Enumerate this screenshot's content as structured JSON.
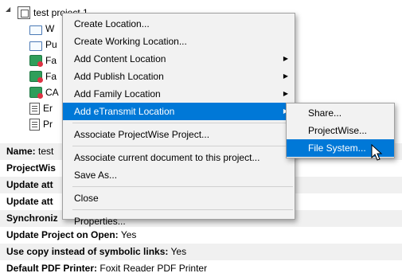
{
  "tree": {
    "root": {
      "label": "test project 1",
      "icon": "project-icon"
    },
    "children": [
      {
        "label": "W",
        "icon": "folder-icon"
      },
      {
        "label": "Pu",
        "icon": "publish-icon"
      },
      {
        "label": "Fa",
        "icon": "family-icon"
      },
      {
        "label": "Fa",
        "icon": "family-icon"
      },
      {
        "label": "CA",
        "icon": "family-icon"
      },
      {
        "label": "Er",
        "icon": "document-icon"
      },
      {
        "label": "Pr",
        "icon": "document-icon"
      }
    ]
  },
  "properties": [
    {
      "key": "Name:",
      "value": "test"
    },
    {
      "key": "ProjectWis",
      "value": ""
    },
    {
      "key": "Update att",
      "value": ""
    },
    {
      "key": "Update att",
      "value": ""
    },
    {
      "key": "Synchroniz",
      "value": ""
    },
    {
      "key": "Update Project on Open:",
      "value": "Yes"
    },
    {
      "key": "Use copy instead of symbolic links:",
      "value": "Yes"
    },
    {
      "key": "Default PDF Printer:",
      "value": "Foxit Reader PDF Printer"
    }
  ],
  "context_menu": {
    "items": [
      {
        "label": "Create Location..."
      },
      {
        "label": "Create Working Location..."
      },
      {
        "label": "Add Content Location"
      },
      {
        "label": "Add Publish Location"
      },
      {
        "label": "Add Family Location"
      },
      {
        "label": "Add eTransmit Location"
      },
      {
        "label": "Associate ProjectWise Project..."
      },
      {
        "label": "Associate current document to this project..."
      },
      {
        "label": "Save As..."
      },
      {
        "label": "Close"
      },
      {
        "label": "Properties..."
      }
    ]
  },
  "submenu": {
    "items": [
      {
        "label": "Share..."
      },
      {
        "label": "ProjectWise..."
      },
      {
        "label": "File System..."
      }
    ]
  },
  "colors": {
    "highlight": "#0078d7",
    "menu_bg": "#f2f2f2"
  }
}
